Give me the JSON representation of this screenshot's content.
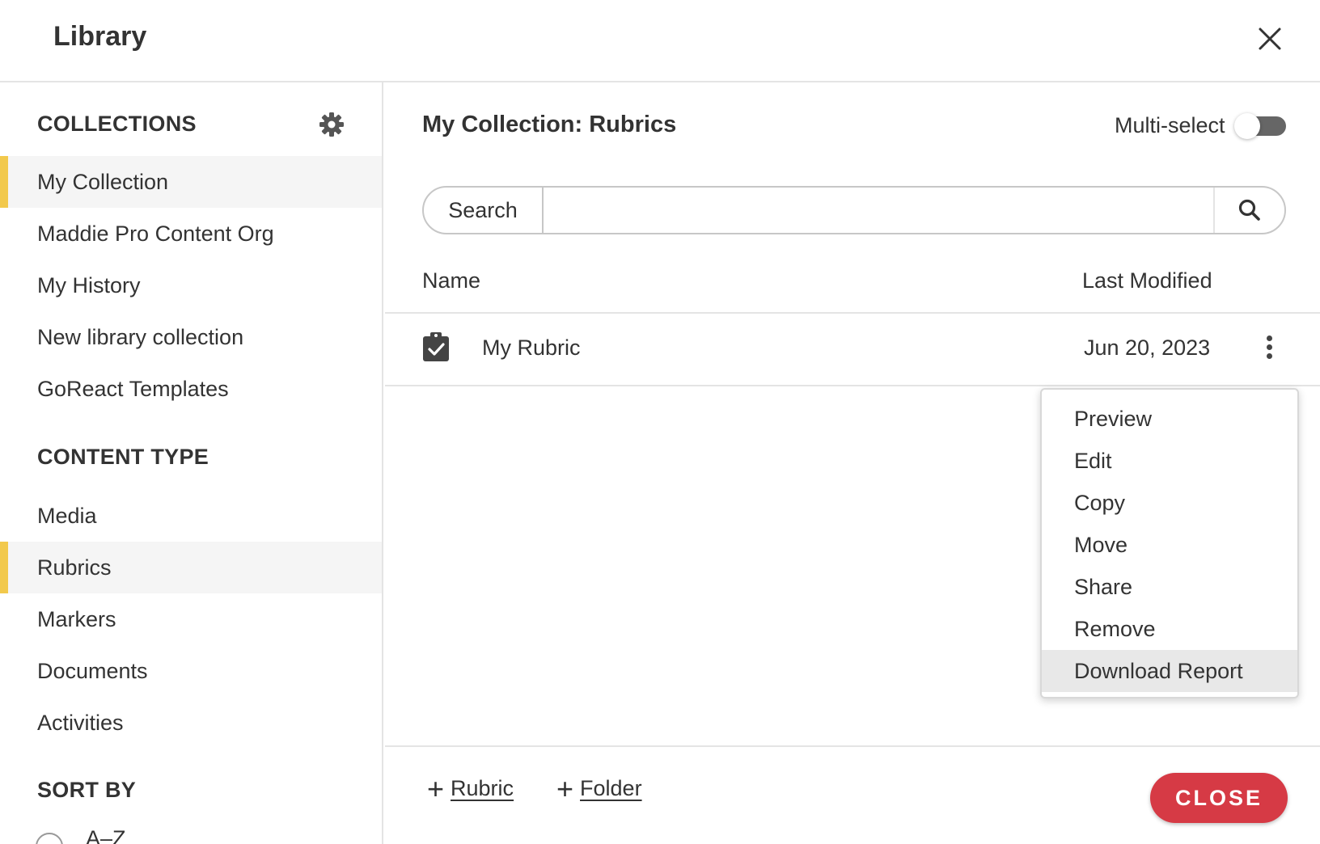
{
  "colors": {
    "accent": "#f2c94c",
    "close_button": "#d63a45",
    "toggle_track": "#666666"
  },
  "header": {
    "title": "Library",
    "close_icon": "close-icon"
  },
  "sidebar": {
    "collections_title": "COLLECTIONS",
    "settings_icon": "gear-icon",
    "collections": [
      {
        "label": "My Collection",
        "active": true
      },
      {
        "label": "Maddie Pro Content Org",
        "active": false
      },
      {
        "label": "My History",
        "active": false
      },
      {
        "label": "New library collection",
        "active": false
      },
      {
        "label": "GoReact Templates",
        "active": false
      }
    ],
    "content_type_title": "CONTENT TYPE",
    "content_types": [
      {
        "label": "Media",
        "active": false
      },
      {
        "label": "Rubrics",
        "active": true
      },
      {
        "label": "Markers",
        "active": false
      },
      {
        "label": "Documents",
        "active": false
      },
      {
        "label": "Activities",
        "active": false
      }
    ],
    "sort_title": "SORT BY",
    "sort_option": "A–Z"
  },
  "main": {
    "title": "My Collection: Rubrics",
    "multiselect_label": "Multi-select",
    "multiselect_on": false,
    "search": {
      "label": "Search",
      "placeholder": "",
      "value": "",
      "icon": "search-icon"
    },
    "columns": {
      "name": "Name",
      "modified": "Last Modified"
    },
    "rows": [
      {
        "name": "My Rubric",
        "modified": "Jun 20, 2023",
        "icon": "clipboard-check-icon"
      }
    ],
    "context_menu": {
      "items": [
        "Preview",
        "Edit",
        "Copy",
        "Move",
        "Share",
        "Remove",
        "Download Report"
      ],
      "hovered": "Download Report"
    },
    "footer": {
      "add_rubric": "Rubric",
      "add_folder": "Folder",
      "close": "CLOSE"
    }
  }
}
